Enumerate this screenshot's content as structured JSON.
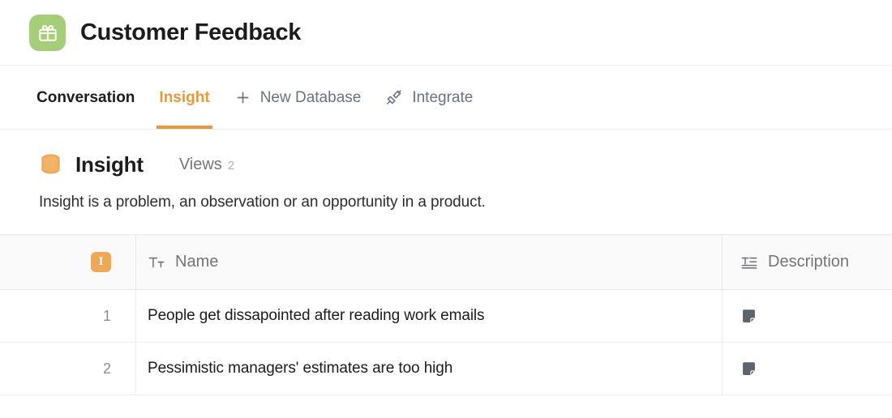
{
  "app": {
    "title": "Customer Feedback",
    "icon": "gift-icon",
    "icon_bg": "#a6ce7a"
  },
  "tabs": [
    {
      "label": "Conversation",
      "icon": null,
      "state": "dark"
    },
    {
      "label": "Insight",
      "icon": null,
      "state": "active"
    },
    {
      "label": "New Database",
      "icon": "plus-icon",
      "state": "normal"
    },
    {
      "label": "Integrate",
      "icon": "plug-icon",
      "state": "normal"
    }
  ],
  "database": {
    "icon": "database-icon",
    "name": "Insight",
    "views_label": "Views",
    "views_count": "2",
    "description": "Insight is a problem, an observation or an opportunity in a product."
  },
  "table": {
    "columns": [
      {
        "key": "num",
        "badge": "I",
        "icon": "index-badge-icon",
        "label": ""
      },
      {
        "key": "name",
        "icon": "text-type-icon",
        "label": "Name"
      },
      {
        "key": "description",
        "icon": "long-text-icon",
        "label": "Description"
      }
    ],
    "rows": [
      {
        "num": "1",
        "name": "People get dissapointed after reading work emails",
        "description_icon": "note-icon"
      },
      {
        "num": "2",
        "name": "Pessimistic managers' estimates are too high",
        "description_icon": "note-icon"
      }
    ]
  },
  "colors": {
    "accent": "#e8993c",
    "badge": "#eda957",
    "app_icon_bg": "#a6ce7a",
    "text": "#1c1c1e",
    "muted": "#71747a"
  }
}
